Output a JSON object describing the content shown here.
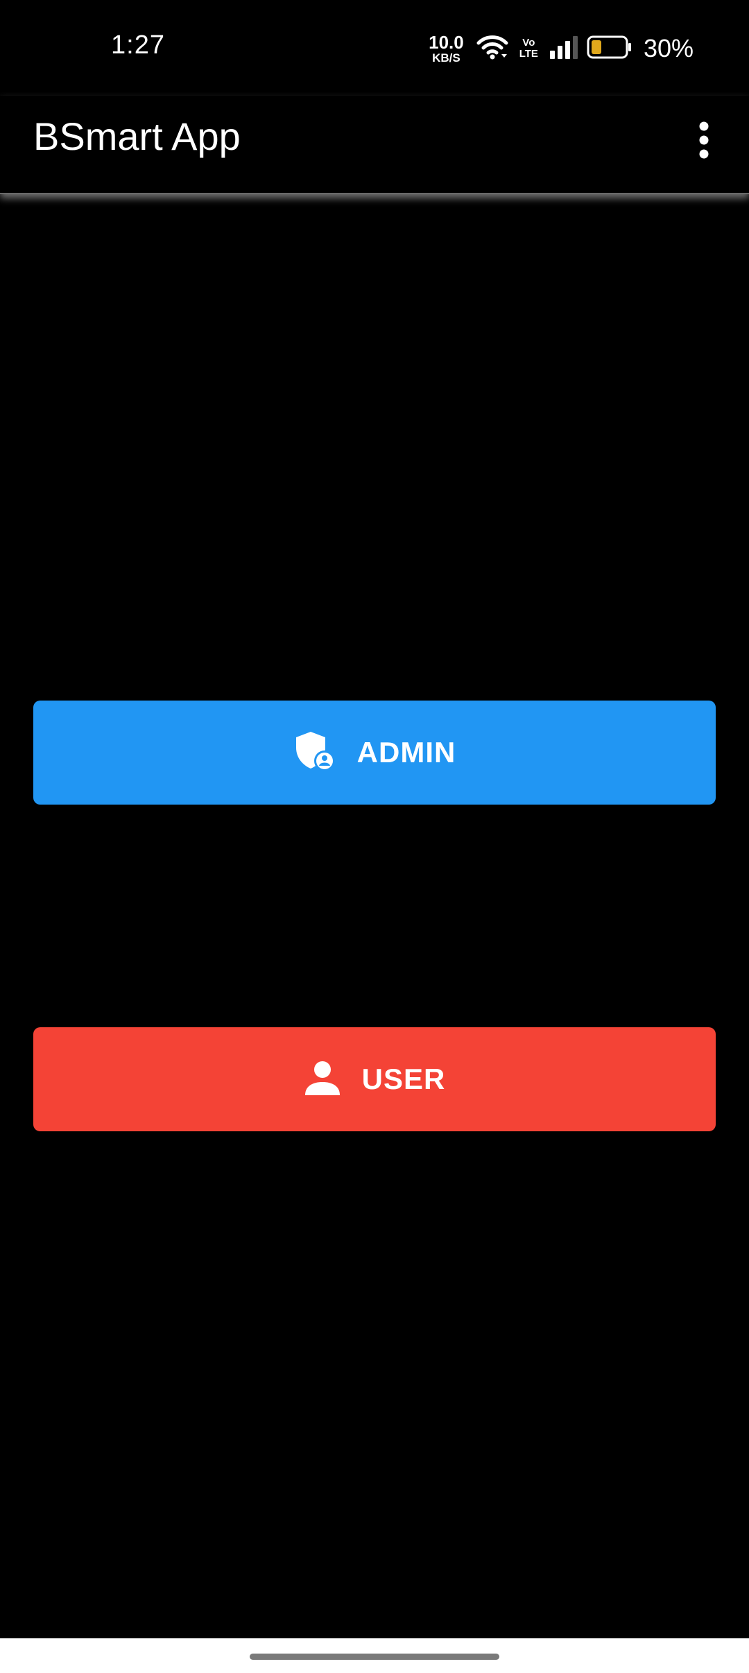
{
  "status_bar": {
    "time": "1:27",
    "net_speed_value": "10.0",
    "net_speed_unit": "KB/S",
    "volte_top": "Vo",
    "volte_bottom": "LTE",
    "battery_percent": "30%",
    "battery_level": 0.3,
    "battery_color": "#E0A81C",
    "icons": [
      "wifi-icon",
      "signal-icon",
      "battery-icon"
    ]
  },
  "app_bar": {
    "title": "BSmart App",
    "menu_icon": "more-vert-icon"
  },
  "buttons": {
    "admin": {
      "label": "ADMIN",
      "icon": "admin-shield-icon",
      "color": "#2196F3"
    },
    "user": {
      "label": "USER",
      "icon": "person-icon",
      "color": "#F44336"
    }
  },
  "theme": {
    "background": "#000000",
    "text": "#FFFFFF"
  }
}
